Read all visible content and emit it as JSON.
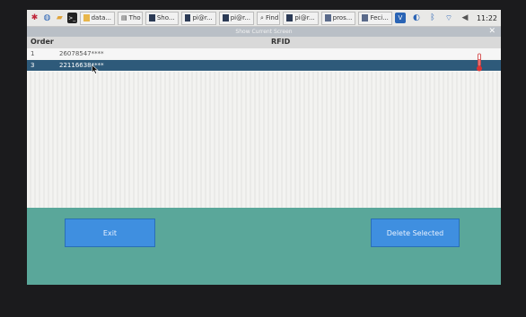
{
  "taskbar": {
    "tasks": [
      {
        "label": "data..."
      },
      {
        "label": "Tho"
      },
      {
        "label": "Sho..."
      },
      {
        "label": "pi@r..."
      },
      {
        "label": "pi@r..."
      },
      {
        "label": "Find"
      },
      {
        "label": "pi@r..."
      },
      {
        "label": "pros..."
      },
      {
        "label": "Feci..."
      }
    ],
    "clock": "11:22"
  },
  "window": {
    "title": "Show Current Screen",
    "close_label": "✕"
  },
  "table": {
    "headers": {
      "order": "Order",
      "rfid": "RFID"
    },
    "rows": [
      {
        "order": "1",
        "rfid": "26078547****"
      },
      {
        "order": "3",
        "rfid": "22116638****"
      }
    ]
  },
  "buttons": {
    "exit_label": "Exit",
    "delete_label": "Delete Selected"
  },
  "colors": {
    "selected_row": "#2e5a7a",
    "bottom_panel": "#5aa79a",
    "button": "#3f8fe0"
  }
}
